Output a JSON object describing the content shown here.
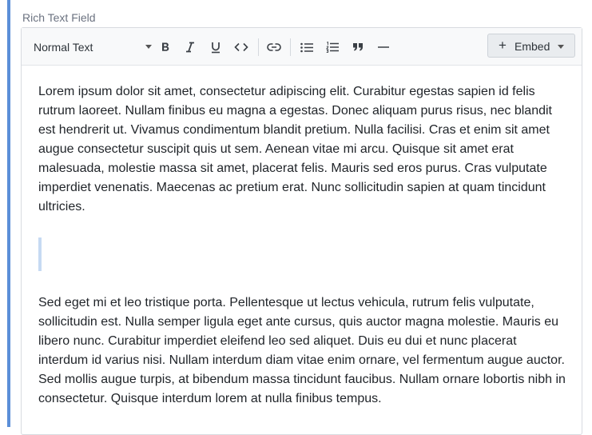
{
  "field": {
    "label": "Rich Text Field"
  },
  "toolbar": {
    "block_style": "Normal Text",
    "buttons": [
      {
        "name": "bold",
        "icon": "bold-icon"
      },
      {
        "name": "italic",
        "icon": "italic-icon"
      },
      {
        "name": "underline",
        "icon": "underline-icon"
      },
      {
        "name": "code",
        "icon": "code-icon"
      },
      {
        "name": "link",
        "icon": "link-icon"
      },
      {
        "name": "bullet-list",
        "icon": "bullet-list-icon"
      },
      {
        "name": "numbered-list",
        "icon": "numbered-list-icon"
      },
      {
        "name": "blockquote",
        "icon": "quote-icon"
      },
      {
        "name": "horizontal-rule",
        "icon": "horizontal-rule-icon"
      }
    ],
    "embed_label": "Embed"
  },
  "content": {
    "paragraph_1": "Lorem ipsum dolor sit amet, consectetur adipiscing elit. Curabitur egestas sapien id felis rutrum laoreet. Nullam finibus eu magna a egestas. Donec aliquam purus risus, nec blandit est hendrerit ut. Vivamus condimentum blandit pretium. Nulla facilisi. Cras et enim sit amet augue consectetur suscipit quis ut sem. Aenean vitae mi arcu. Quisque sit amet erat malesuada, molestie massa sit amet, placerat felis. Mauris sed eros purus. Cras vulputate imperdiet venenatis. Maecenas ac pretium erat. Nunc sollicitudin sapien at quam tincidunt ultricies.",
    "paragraph_2": "Sed eget mi et leo tristique porta. Pellentesque ut lectus vehicula, rutrum felis vulputate, sollicitudin est. Nulla semper ligula eget ante cursus, quis auctor magna molestie. Mauris eu libero nunc. Curabitur imperdiet eleifend leo sed aliquet. Duis eu dui et nunc placerat interdum id varius nisi. Nullam interdum diam vitae enim ornare, vel fermentum augue auctor. Sed mollis augue turpis, at bibendum massa tincidunt faucibus. Nullam ornare lobortis nibh in consectetur. Quisque interdum lorem at nulla finibus tempus."
  },
  "colors": {
    "accent": "#5b8fd8",
    "empty_block_marker": "#c6daf3"
  }
}
